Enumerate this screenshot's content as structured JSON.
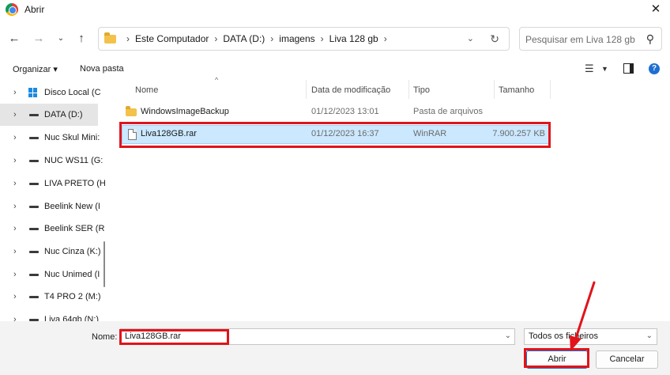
{
  "window": {
    "title": "Abrir",
    "close_icon": "close-icon",
    "app_icon": "chrome-icon"
  },
  "navigation": {
    "back_icon": "arrow-left-icon",
    "forward_icon": "arrow-right-icon",
    "recent_icon": "chevron-down-icon",
    "up_icon": "arrow-up-icon"
  },
  "address": {
    "crumbs": [
      "Este Computador",
      "DATA (D:)",
      "imagens",
      "Liva 128 gb"
    ],
    "refresh_icon": "refresh-icon"
  },
  "search": {
    "placeholder": "Pesquisar em Liva 128 gb",
    "icon": "search-icon"
  },
  "toolbar": {
    "organize": "Organizar ▾",
    "new_folder": "Nova pasta"
  },
  "sidebar": {
    "items": [
      {
        "label": "Disco Local (C",
        "icon": "windows-drive-icon",
        "selected": false
      },
      {
        "label": "DATA (D:)",
        "icon": "drive-icon",
        "selected": true
      },
      {
        "label": "Nuc Skul Mini:",
        "icon": "drive-icon",
        "selected": false
      },
      {
        "label": "NUC WS11 (G:",
        "icon": "drive-icon",
        "selected": false
      },
      {
        "label": "LIVA PRETO (H",
        "icon": "drive-icon",
        "selected": false
      },
      {
        "label": "Beelink New (I",
        "icon": "drive-icon",
        "selected": false
      },
      {
        "label": "Beelink SER (R",
        "icon": "drive-icon",
        "selected": false
      },
      {
        "label": "Nuc Cinza (K:)",
        "icon": "drive-icon",
        "selected": false
      },
      {
        "label": "Nuc Unimed (I",
        "icon": "drive-icon",
        "selected": false
      },
      {
        "label": "T4 PRO 2 (M:)",
        "icon": "drive-icon",
        "selected": false
      },
      {
        "label": "Liva 64gb (N:)",
        "icon": "drive-icon",
        "selected": false
      }
    ]
  },
  "files": {
    "columns": [
      "Nome",
      "Data de modificação",
      "Tipo",
      "Tamanho"
    ],
    "rows": [
      {
        "name": "WindowsImageBackup",
        "modified": "01/12/2023 13:01",
        "type": "Pasta de arquivos",
        "size": "",
        "icon": "folder-icon",
        "selected": false
      },
      {
        "name": "Liva128GB.rar",
        "modified": "01/12/2023 16:37",
        "type": "WinRAR",
        "size": "7.900.257 KB",
        "icon": "file-icon",
        "selected": true
      }
    ]
  },
  "footer": {
    "name_label": "Nome:",
    "name_value": "Liva128GB.rar",
    "filter_value": "Todos os ficheiros",
    "open_label": "Abrir",
    "cancel_label": "Cancelar"
  },
  "annotation": {
    "highlight_color": "#e0141b"
  }
}
